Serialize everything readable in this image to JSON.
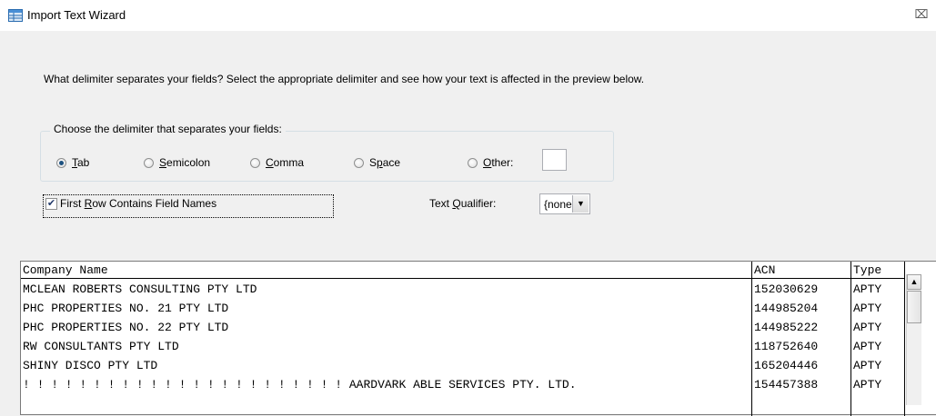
{
  "window": {
    "title": "Import Text Wizard",
    "close_glyph": "⌧",
    "icon": "table-wizard-icon"
  },
  "prompt": "What delimiter separates your fields? Select the appropriate delimiter and see how your text is affected in the preview below.",
  "delimiter_group": {
    "label": "Choose the delimiter that separates your fields:",
    "options": [
      {
        "label": "Tab",
        "accesskey": "T",
        "rest": "ab",
        "checked": true
      },
      {
        "label": "Semicolon",
        "accesskey": "S",
        "rest": "emicolon",
        "checked": false
      },
      {
        "label": "Comma",
        "accesskey": "C",
        "rest": "omma",
        "checked": false
      },
      {
        "label": "Space",
        "prefix": "S",
        "accesskey": "p",
        "rest": "ace",
        "checked": false
      },
      {
        "label": "Other:",
        "accesskey": "O",
        "rest": "ther:",
        "checked": false
      }
    ],
    "other_value": ""
  },
  "first_row": {
    "checked": true,
    "check_glyph": "✔",
    "label_prefix": "First ",
    "label_key": "R",
    "label_rest": "ow Contains Field Names"
  },
  "text_qualifier": {
    "label_prefix": "Text ",
    "label_key": "Q",
    "label_rest": "ualifier:",
    "value": "{none}",
    "arrow_glyph": "▼"
  },
  "preview": {
    "headers": [
      "Company Name",
      "ACN",
      "Type"
    ],
    "rows": [
      [
        "MCLEAN ROBERTS CONSULTING PTY LTD",
        "152030629",
        "APTY"
      ],
      [
        "PHC PROPERTIES NO. 21 PTY LTD",
        "144985204",
        "APTY"
      ],
      [
        "PHC PROPERTIES NO. 22 PTY LTD",
        "144985222",
        "APTY"
      ],
      [
        "RW CONSULTANTS PTY LTD",
        "118752640",
        "APTY"
      ],
      [
        "SHINY DISCO PTY LTD",
        "165204446",
        "APTY"
      ],
      [
        "! ! ! ! ! ! ! ! ! ! ! ! ! ! ! ! ! ! ! ! ! ! ! AARDVARK ABLE SERVICES PTY. LTD.",
        "154457388",
        "APTY"
      ]
    ],
    "scroll_up_glyph": "▲"
  }
}
